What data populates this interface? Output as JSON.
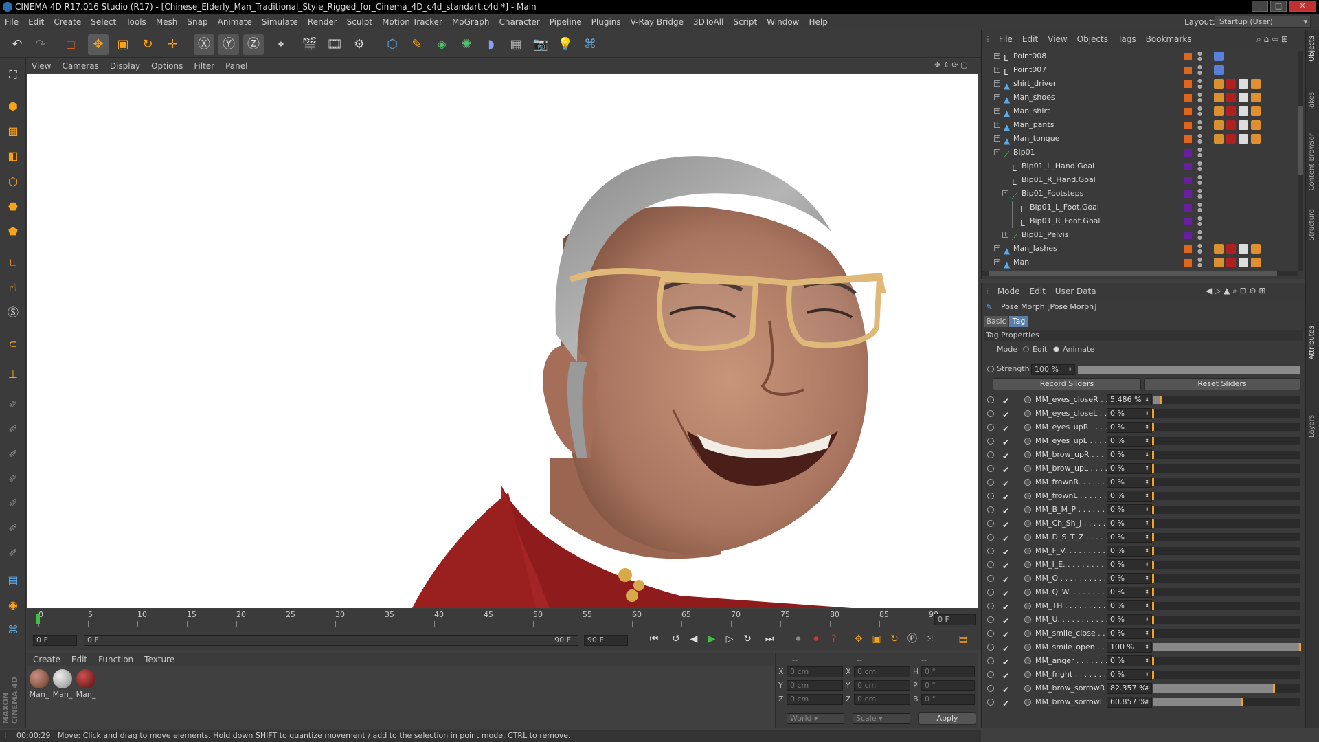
{
  "window": {
    "title": "CINEMA 4D R17.016 Studio (R17) - [Chinese_Elderly_Man_Traditional_Style_Rigged_for_Cinema_4D_c4d_standart.c4d *] - Main"
  },
  "menubar": {
    "items": [
      "File",
      "Edit",
      "Create",
      "Select",
      "Tools",
      "Mesh",
      "Snap",
      "Animate",
      "Simulate",
      "Render",
      "Sculpt",
      "Motion Tracker",
      "MoGraph",
      "Character",
      "Pipeline",
      "Plugins",
      "V-Ray Bridge",
      "3DToAll",
      "Script",
      "Window",
      "Help"
    ]
  },
  "layout": {
    "label": "Layout:",
    "value": "Startup (User)"
  },
  "viewport": {
    "menu": [
      "View",
      "Cameras",
      "Display",
      "Options",
      "Filter",
      "Panel"
    ]
  },
  "timeline": {
    "ticks": [
      "0",
      "5",
      "10",
      "15",
      "20",
      "25",
      "30",
      "35",
      "40",
      "45",
      "50",
      "55",
      "60",
      "65",
      "70",
      "75",
      "80",
      "85",
      "90"
    ],
    "frame_display": "0 F",
    "current_frame": "0 F",
    "range_start": "0 F",
    "range_end": "90 F",
    "end_frame": "90 F",
    "scrub_left": "0 F"
  },
  "materials": {
    "menu": [
      "Create",
      "Edit",
      "Function",
      "Texture"
    ],
    "items": [
      "Man_",
      "Man_",
      "Man_"
    ]
  },
  "coords": {
    "header": [
      "--",
      "--",
      "--"
    ],
    "rows": [
      {
        "axis": "X",
        "pos": "0 cm",
        "axis2": "X",
        "size": "0 cm",
        "axis3": "H",
        "rot": "0 °"
      },
      {
        "axis": "Y",
        "pos": "0 cm",
        "axis2": "Y",
        "size": "0 cm",
        "axis3": "P",
        "rot": "0 °"
      },
      {
        "axis": "Z",
        "pos": "0 cm",
        "axis2": "Z",
        "size": "0 cm",
        "axis3": "B",
        "rot": "0 °"
      }
    ],
    "space": "World",
    "mode": "Scale",
    "apply": "Apply"
  },
  "status": {
    "time": "00:00:29",
    "message": "Move: Click and drag to move elements. Hold down SHIFT to quantize movement / add to the selection in point mode, CTRL to remove."
  },
  "objects": {
    "menu": [
      "File",
      "Edit",
      "View",
      "Objects",
      "Tags",
      "Bookmarks"
    ],
    "rows": [
      {
        "name": "Point008",
        "indent": 0,
        "icon": "null-icon",
        "color": "#e0661c",
        "exp": "+"
      },
      {
        "name": "Point007",
        "indent": 0,
        "icon": "null-icon",
        "color": "#e0661c",
        "exp": "+"
      },
      {
        "name": "shirt_driver",
        "indent": 0,
        "icon": "polygon-icon",
        "color": "#e0661c",
        "exp": "+"
      },
      {
        "name": "Man_shoes",
        "indent": 0,
        "icon": "polygon-icon",
        "color": "#e0661c",
        "exp": "+"
      },
      {
        "name": "Man_shirt",
        "indent": 0,
        "icon": "polygon-icon",
        "color": "#e0661c",
        "exp": "+"
      },
      {
        "name": "Man_pants",
        "indent": 0,
        "icon": "polygon-icon",
        "color": "#e0661c",
        "exp": "+"
      },
      {
        "name": "Man_tongue",
        "indent": 0,
        "icon": "polygon-icon",
        "color": "#e0661c",
        "exp": "+"
      },
      {
        "name": "Bip01",
        "indent": 0,
        "icon": "bone-icon",
        "color": "#6a1fa0",
        "exp": "-"
      },
      {
        "name": "Bip01_L_Hand.Goal",
        "indent": 1,
        "icon": "null-icon",
        "color": "#6a1fa0",
        "exp": ""
      },
      {
        "name": "Bip01_R_Hand.Goal",
        "indent": 1,
        "icon": "null-icon",
        "color": "#6a1fa0",
        "exp": ""
      },
      {
        "name": "Bip01_Footsteps",
        "indent": 1,
        "icon": "bone-icon",
        "color": "#6a1fa0",
        "exp": "-"
      },
      {
        "name": "Bip01_L_Foot.Goal",
        "indent": 2,
        "icon": "null-icon",
        "color": "#6a1fa0",
        "exp": ""
      },
      {
        "name": "Bip01_R_Foot.Goal",
        "indent": 2,
        "icon": "null-icon",
        "color": "#6a1fa0",
        "exp": ""
      },
      {
        "name": "Bip01_Pelvis",
        "indent": 1,
        "icon": "bone-icon",
        "color": "#6a1fa0",
        "exp": "+"
      },
      {
        "name": "Man_lashes",
        "indent": 0,
        "icon": "polygon-icon",
        "color": "#e0661c",
        "exp": "+"
      },
      {
        "name": "Man",
        "indent": 0,
        "icon": "polygon-icon",
        "color": "#e0661c",
        "exp": "+"
      }
    ]
  },
  "attributes": {
    "menu": [
      "Mode",
      "Edit",
      "User Data"
    ],
    "title": "Pose Morph [Pose Morph]",
    "tabs": [
      "Basic",
      "Tag"
    ],
    "section": "Tag Properties",
    "mode_label": "Mode",
    "mode_options": [
      "Edit",
      "Animate"
    ],
    "strength_label": "Strength",
    "strength_value": "100 %",
    "strength_level": 1.0,
    "record_button": "Record Sliders",
    "reset_button": "Reset Sliders",
    "morphs": [
      {
        "name": "MM_eyes_closeR . . . .",
        "value": "5.486 %",
        "level": 0.05486
      },
      {
        "name": "MM_eyes_closeL . . . .",
        "value": "0 %",
        "level": 0
      },
      {
        "name": "MM_eyes_upR . . . . . .",
        "value": "0 %",
        "level": 0
      },
      {
        "name": "MM_eyes_upL . . . . . .",
        "value": "0 %",
        "level": 0
      },
      {
        "name": "MM_brow_upR . . . . .",
        "value": "0 %",
        "level": 0
      },
      {
        "name": "MM_brow_upL . . . . . .",
        "value": "0 %",
        "level": 0
      },
      {
        "name": "MM_frownR. . . . . . . .",
        "value": "0 %",
        "level": 0
      },
      {
        "name": "MM_frownL . . . . . . . .",
        "value": "0 %",
        "level": 0
      },
      {
        "name": "MM_B_M_P . . . . . . . .",
        "value": "0 %",
        "level": 0
      },
      {
        "name": "MM_Ch_Sh_J . . . . . . .",
        "value": "0 %",
        "level": 0
      },
      {
        "name": "MM_D_S_T_Z . . . . . .",
        "value": "0 %",
        "level": 0
      },
      {
        "name": "MM_F_V. . . . . . . . . . .",
        "value": "0 %",
        "level": 0
      },
      {
        "name": "MM_I_E. . . . . . . . . . .",
        "value": "0 %",
        "level": 0
      },
      {
        "name": "MM_O . . . . . . . . . . .",
        "value": "0 %",
        "level": 0
      },
      {
        "name": "MM_Q_W. . . . . . . . . .",
        "value": "0 %",
        "level": 0
      },
      {
        "name": "MM_TH . . . . . . . . . . .",
        "value": "0 %",
        "level": 0
      },
      {
        "name": "MM_U. . . . . . . . . . . .",
        "value": "0 %",
        "level": 0
      },
      {
        "name": "MM_smile_close . . . .",
        "value": "0 %",
        "level": 0
      },
      {
        "name": "MM_smile_open . . . .",
        "value": "100 %",
        "level": 1.0
      },
      {
        "name": "MM_anger . . . . . . . . .",
        "value": "0 %",
        "level": 0
      },
      {
        "name": "MM_fright . . . . . . . . .",
        "value": "0 %",
        "level": 0
      },
      {
        "name": "MM_brow_sorrowR",
        "value": "82.357 %",
        "level": 0.82357
      },
      {
        "name": "MM_brow_sorrowL",
        "value": "60.857 %",
        "level": 0.60857
      }
    ]
  },
  "right_tabs": [
    "Objects",
    "Takes",
    "Content Browser",
    "Structure",
    "Attributes",
    "Layers"
  ],
  "colors": {
    "accent": "#f7a21b",
    "panel": "#3a3a3a",
    "viewport": "#ffffff"
  }
}
